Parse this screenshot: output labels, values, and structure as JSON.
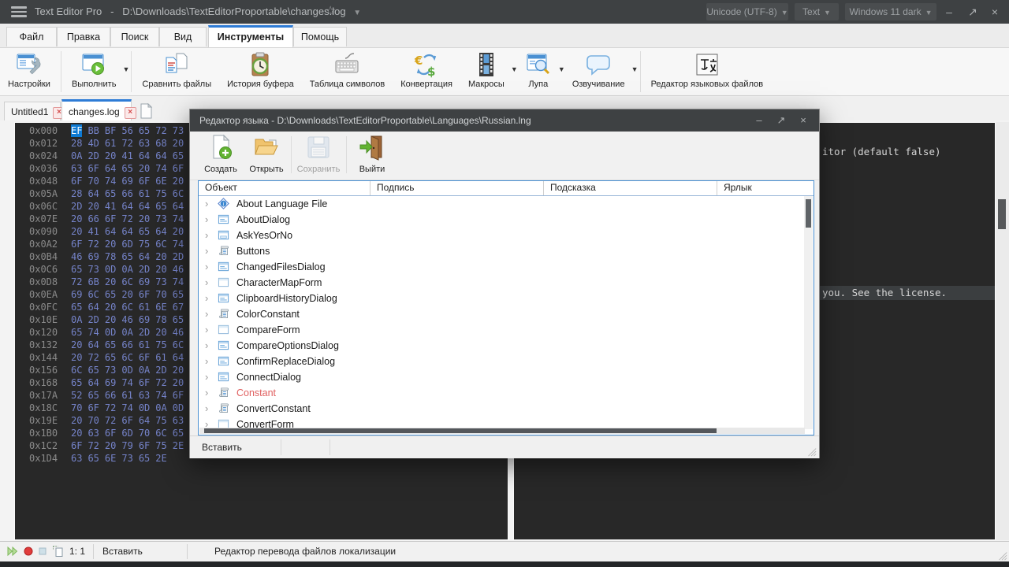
{
  "colors": {
    "accent_blue": "#2e7cd6",
    "titlebar_dark": "#3e4143",
    "editor_bg": "#282828",
    "hex_byte": "#7583c9",
    "hex_address": "#8a8a8a",
    "selection_blue": "#0d7ad4",
    "constant_red": "#e06060"
  },
  "window": {
    "app_title": "Text Editor Pro",
    "title_separator": "-",
    "file_path": "D:\\Downloads\\TextEditorProportable\\changes.log",
    "encoding_dropdown": "Unicode (UTF-8)",
    "doc_type_dropdown": "Text",
    "theme_dropdown": "Windows 11 dark",
    "minimize_glyph": "–",
    "maximize_glyph": "↗",
    "close_glyph": "×",
    "star_glyph": "☆"
  },
  "menu_tabs": [
    {
      "label": "Файл",
      "active": false
    },
    {
      "label": "Правка",
      "active": false
    },
    {
      "label": "Поиск",
      "active": false
    },
    {
      "label": "Вид",
      "active": false
    },
    {
      "label": "Инструменты",
      "active": true
    },
    {
      "label": "Помощь",
      "active": false
    }
  ],
  "toolbar": [
    {
      "label": "Настройки",
      "icon": "settings",
      "caret": false,
      "sep_after": true
    },
    {
      "label": "Выполнить",
      "icon": "run",
      "caret": true,
      "sep_after": true
    },
    {
      "label": "Сравнить файлы",
      "icon": "compare",
      "caret": false,
      "sep_after": false
    },
    {
      "label": "История буфера",
      "icon": "clipboard",
      "caret": false,
      "sep_after": false
    },
    {
      "label": "Таблица символов",
      "icon": "charmap",
      "caret": false,
      "sep_after": false
    },
    {
      "label": "Конвертация",
      "icon": "convert",
      "caret": false,
      "sep_after": false
    },
    {
      "label": "Макросы",
      "icon": "macros",
      "caret": true,
      "sep_after": false
    },
    {
      "label": "Лупа",
      "icon": "magnifier",
      "caret": true,
      "sep_after": false
    },
    {
      "label": "Озвучивание",
      "icon": "speech",
      "caret": true,
      "sep_after": true
    },
    {
      "label": "Редактор языковых файлов",
      "icon": "langedit",
      "caret": false,
      "sep_after": false
    }
  ],
  "doc_tabs": [
    {
      "label": "Untitled1",
      "active": false
    },
    {
      "label": "changes.log",
      "active": true
    }
  ],
  "hex": {
    "selected": {
      "row": 0,
      "byte": 0
    },
    "rows": [
      {
        "addr": "0x000",
        "bytes": "EF BB BF 56 65 72 73"
      },
      {
        "addr": "0x012",
        "bytes": "28 4D 61 72 63 68 20"
      },
      {
        "addr": "0x024",
        "bytes": "0A 2D 20 41 64 64 65"
      },
      {
        "addr": "0x036",
        "bytes": "63 6F 64 65 20 74 6F"
      },
      {
        "addr": "0x048",
        "bytes": "6F 70 74 69 6F 6E 20"
      },
      {
        "addr": "0x05A",
        "bytes": "28 64 65 66 61 75 6C"
      },
      {
        "addr": "0x06C",
        "bytes": "2D 20 41 64 64 65 64"
      },
      {
        "addr": "0x07E",
        "bytes": "20 66 6F 72 20 73 74"
      },
      {
        "addr": "0x090",
        "bytes": "20 41 64 64 65 64 20"
      },
      {
        "addr": "0x0A2",
        "bytes": "6F 72 20 6D 75 6C 74"
      },
      {
        "addr": "0x0B4",
        "bytes": "46 69 78 65 64 20 2D"
      },
      {
        "addr": "0x0C6",
        "bytes": "65 73 0D 0A 2D 20 46"
      },
      {
        "addr": "0x0D8",
        "bytes": "72 6B 20 6C 69 73 74"
      },
      {
        "addr": "0x0EA",
        "bytes": "69 6C 65 20 6F 70 65"
      },
      {
        "addr": "0x0FC",
        "bytes": "65 64 20 6C 61 6E 67"
      },
      {
        "addr": "0x10E",
        "bytes": "0A 2D 20 46 69 78 65"
      },
      {
        "addr": "0x120",
        "bytes": "65 74 0D 0A 2D 20 46"
      },
      {
        "addr": "0x132",
        "bytes": "20 64 65 66 61 75 6C"
      },
      {
        "addr": "0x144",
        "bytes": "20 72 65 6C 6F 61 64"
      },
      {
        "addr": "0x156",
        "bytes": "6C 65 73 0D 0A 2D 20"
      },
      {
        "addr": "0x168",
        "bytes": "65 64 69 74 6F 72 20"
      },
      {
        "addr": "0x17A",
        "bytes": "52 65 66 61 63 74 6F"
      },
      {
        "addr": "0x18C",
        "bytes": "70 6F 72 74 0D 0A 0D"
      },
      {
        "addr": "0x19E",
        "bytes": "20 70 72 6F 64 75 63"
      },
      {
        "addr": "0x1B0",
        "bytes": "20 63 6F 6D 70 6C 65"
      },
      {
        "addr": "0x1C2",
        "bytes": "6F 72 20 79 6F 75 2E"
      },
      {
        "addr": "0x1D4",
        "bytes": "63 65 6E 73 65 2E"
      }
    ]
  },
  "background_editor": {
    "visible_line_1": "itor (default false)",
    "visible_line_2": "you. See the license."
  },
  "dialog": {
    "title": "Редактор языка - D:\\Downloads\\TextEditorProportable\\Languages\\Russian.lng",
    "minimize_glyph": "–",
    "maximize_glyph": "↗",
    "close_glyph": "×",
    "toolbar": [
      {
        "label": "Создать",
        "icon": "create",
        "disabled": false
      },
      {
        "label": "Открыть",
        "icon": "open",
        "disabled": false
      },
      {
        "label": "Сохранить",
        "icon": "save",
        "disabled": true
      },
      {
        "label": "Выйти",
        "icon": "exit",
        "disabled": false
      }
    ],
    "columns": [
      "Объект",
      "Подпись",
      "Подсказка",
      "Ярлык"
    ],
    "items": [
      {
        "label": "About Language File",
        "icon": "info",
        "red": false
      },
      {
        "label": "AboutDialog",
        "icon": "dialog",
        "red": false
      },
      {
        "label": "AskYesOrNo",
        "icon": "ask",
        "red": false
      },
      {
        "label": "Buttons",
        "icon": "script",
        "red": false
      },
      {
        "label": "ChangedFilesDialog",
        "icon": "dialog",
        "red": false
      },
      {
        "label": "CharacterMapForm",
        "icon": "form",
        "red": false
      },
      {
        "label": "ClipboardHistoryDialog",
        "icon": "dialog",
        "red": false
      },
      {
        "label": "ColorConstant",
        "icon": "script",
        "red": false
      },
      {
        "label": "CompareForm",
        "icon": "form",
        "red": false
      },
      {
        "label": "CompareOptionsDialog",
        "icon": "dialog",
        "red": false
      },
      {
        "label": "ConfirmReplaceDialog",
        "icon": "dialog",
        "red": false
      },
      {
        "label": "ConnectDialog",
        "icon": "dialog",
        "red": false
      },
      {
        "label": "Constant",
        "icon": "script",
        "red": true
      },
      {
        "label": "ConvertConstant",
        "icon": "script",
        "red": false
      },
      {
        "label": "ConvertForm",
        "icon": "form",
        "red": false
      }
    ],
    "status_insert": "Вставить"
  },
  "statusbar": {
    "caret_position": "1: 1",
    "insert_mode": "Вставить",
    "hint": "Редактор перевода файлов локализации"
  }
}
